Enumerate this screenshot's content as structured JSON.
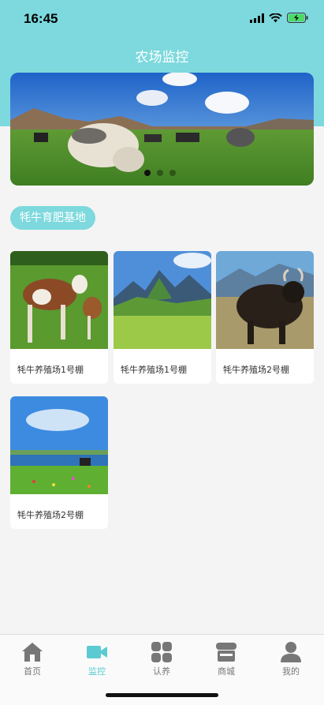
{
  "status_bar": {
    "time": "16:45"
  },
  "header": {
    "title": "农场监控"
  },
  "banner": {
    "slide_count": 3,
    "active_slide": 1
  },
  "section": {
    "title": "牦牛育肥基地"
  },
  "cards": [
    {
      "label": "牦牛养殖场1号棚"
    },
    {
      "label": "牦牛养殖场1号棚"
    },
    {
      "label": "牦牛养殖场2号棚"
    },
    {
      "label": "牦牛养殖场2号棚"
    }
  ],
  "tabbar": {
    "items": [
      {
        "label": "首页",
        "icon": "home-icon"
      },
      {
        "label": "监控",
        "icon": "video-camera-icon"
      },
      {
        "label": "认养",
        "icon": "grid-icon"
      },
      {
        "label": "商城",
        "icon": "store-icon"
      },
      {
        "label": "我的",
        "icon": "user-icon"
      }
    ],
    "active_index": 1,
    "active_color": "#5ccbd1",
    "inactive_color": "#777777"
  },
  "colors": {
    "accent": "#7dd9dd"
  }
}
